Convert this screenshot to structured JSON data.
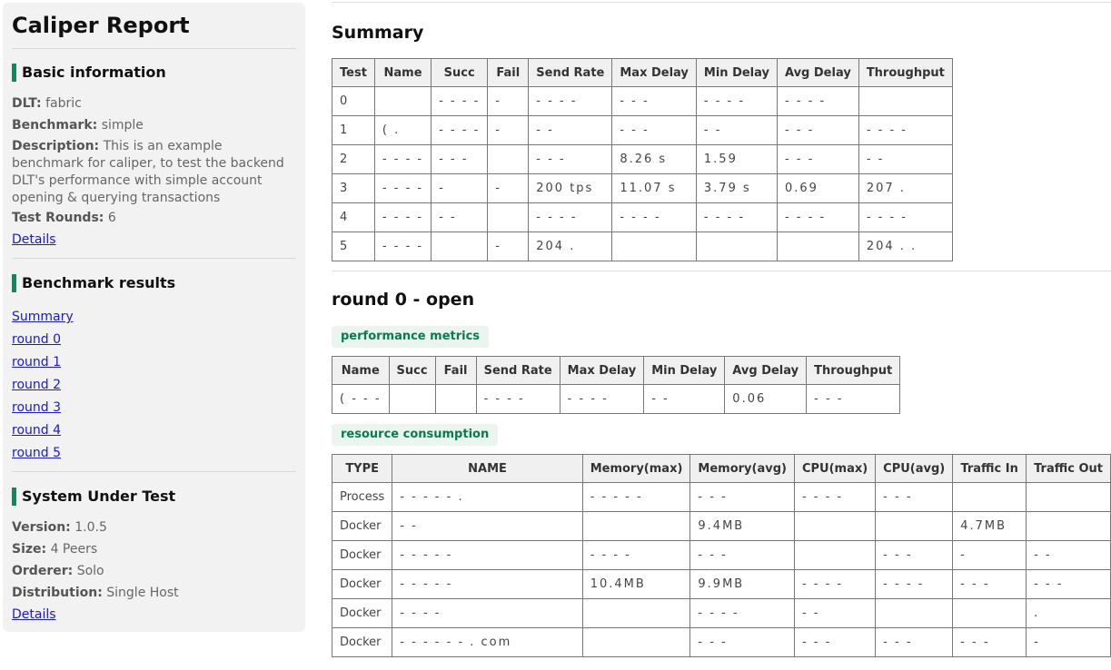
{
  "sidebar": {
    "title": "Caliper Report",
    "basic": {
      "heading": "Basic information",
      "dlt_label": "DLT:",
      "dlt_value": "fabric",
      "benchmark_label": "Benchmark:",
      "benchmark_value": "simple",
      "description_label": "Description:",
      "description_value": "This is an example benchmark for caliper, to test the backend DLT's performance with simple account opening & querying transactions",
      "rounds_label": "Test Rounds:",
      "rounds_value": "6",
      "details": "Details"
    },
    "results": {
      "heading": "Benchmark results",
      "links": [
        "Summary",
        "round 0",
        "round 1",
        "round 2",
        "round 3",
        "round 4",
        "round 5"
      ]
    },
    "sut": {
      "heading": "System Under Test",
      "version_label": "Version:",
      "version_value": "1.0.5",
      "size_label": "Size:",
      "size_value": "4 Peers",
      "orderer_label": "Orderer:",
      "orderer_value": "Solo",
      "distribution_label": "Distribution:",
      "distribution_value": "Single Host",
      "details": "Details"
    }
  },
  "summary": {
    "title": "Summary",
    "headers": [
      "Test",
      "Name",
      "Succ",
      "Fail",
      "Send Rate",
      "Max Delay",
      "Min Delay",
      "Avg Delay",
      "Throughput"
    ],
    "rows": [
      [
        "0",
        "",
        "- - - -",
        "-",
        "- - - -",
        "- - -",
        "- - - -",
        "- - - -",
        ""
      ],
      [
        "1",
        "( .",
        "- - - -",
        "-",
        "- -",
        "- - -",
        "- -",
        "- - -",
        "- - - -"
      ],
      [
        "2",
        "- - - -",
        "- - -",
        "",
        "- - -",
        "8.26 s",
        "1.59",
        "- - -",
        "- -"
      ],
      [
        "3",
        "- - - -",
        "-",
        "-",
        "200 tps",
        "11.07 s",
        "3.79 s",
        "0.69",
        "207 ."
      ],
      [
        "4",
        "- - - -",
        "- -",
        "",
        "- - - -",
        "- - - -",
        "- - - -",
        "- - - -",
        "- - - -"
      ],
      [
        "5",
        "- - - -",
        "",
        "-",
        "204 .",
        "",
        "",
        "",
        "204 . ."
      ]
    ]
  },
  "round0": {
    "title": "round 0 - open",
    "perf_label": "performance metrics",
    "perf_headers": [
      "Name",
      "Succ",
      "Fail",
      "Send Rate",
      "Max Delay",
      "Min Delay",
      "Avg Delay",
      "Throughput"
    ],
    "perf_rows": [
      [
        "( - - -",
        "",
        "",
        "- - - -",
        "- - - -",
        "- -",
        "0.06",
        "- - -"
      ]
    ],
    "res_label": "resource consumption",
    "res_headers": [
      "TYPE",
      "NAME",
      "Memory(max)",
      "Memory(avg)",
      "CPU(max)",
      "CPU(avg)",
      "Traffic In",
      "Traffic Out"
    ],
    "res_rows": [
      [
        "Process",
        "- -   - - -   .",
        "- - - - -",
        "- - -",
        "- - - -",
        "- - -",
        "",
        ""
      ],
      [
        "Docker",
        "- -",
        "",
        "9.4MB",
        "",
        "",
        "4.7MB",
        ""
      ],
      [
        "Docker",
        "- - - - -",
        "- - - -",
        "- - -",
        "",
        "- - -",
        "-",
        "- -"
      ],
      [
        "Docker",
        "- - - - -",
        "10.4MB",
        "9.9MB",
        "- - - -",
        "- - - -",
        "- - -",
        "- - -"
      ],
      [
        "Docker",
        "- - - -",
        "",
        "- - - -",
        "- -",
        "",
        "",
        "."
      ],
      [
        "Docker",
        "- -   - - - - . com",
        "",
        "- - -",
        "- - -",
        "- - -",
        "- - -",
        "-"
      ]
    ]
  }
}
